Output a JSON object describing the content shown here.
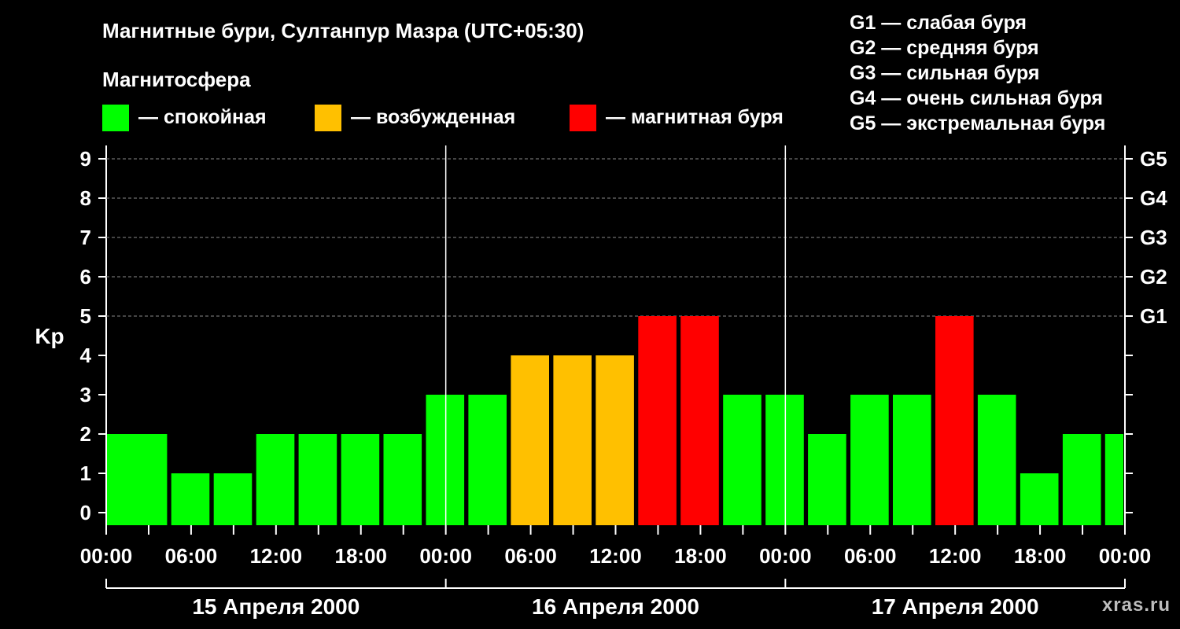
{
  "title": "Магнитные бури, Султанпур Мазра (UTC+05:30)",
  "magnetosphere_legend": {
    "title": "Магнитосфера",
    "items": [
      {
        "label": "— спокойная",
        "color": "#00ff00"
      },
      {
        "label": "— возбужденная",
        "color": "#ffc000"
      },
      {
        "label": "— магнитная буря",
        "color": "#ff0000"
      }
    ]
  },
  "storm_levels": [
    "G1 — слабая буря",
    "G2 — средняя буря",
    "G3 — сильная буря",
    "G4 — очень сильная буря",
    "G5 — экстремальная буря"
  ],
  "site": "xras.ru",
  "chart_data": {
    "type": "bar",
    "ylabel": "Kp",
    "ylim": [
      0,
      9
    ],
    "y_ticks": [
      "0",
      "1",
      "2",
      "3",
      "4",
      "5",
      "6",
      "7",
      "8",
      "9"
    ],
    "right_axis_labels": [
      {
        "kp": 5,
        "label": "G1"
      },
      {
        "kp": 6,
        "label": "G2"
      },
      {
        "kp": 7,
        "label": "G3"
      },
      {
        "kp": 8,
        "label": "G4"
      },
      {
        "kp": 9,
        "label": "G5"
      }
    ],
    "x_tick_labels": [
      "00:00",
      "06:00",
      "12:00",
      "18:00",
      "00:00",
      "06:00",
      "12:00",
      "18:00",
      "00:00",
      "06:00",
      "12:00",
      "18:00",
      "00:00"
    ],
    "days": [
      "15 Апреля 2000",
      "16 Апреля 2000",
      "17 Апреля 2000"
    ],
    "values": [
      2,
      2,
      1,
      1,
      2,
      2,
      2,
      2,
      3,
      3,
      4,
      4,
      4,
      5,
      5,
      3,
      3,
      2,
      3,
      3,
      5,
      3,
      1,
      2,
      2
    ],
    "colors": {
      "quiet": "#00ff00",
      "unsettled": "#ffc000",
      "storm": "#ff0000"
    },
    "grid": true
  }
}
